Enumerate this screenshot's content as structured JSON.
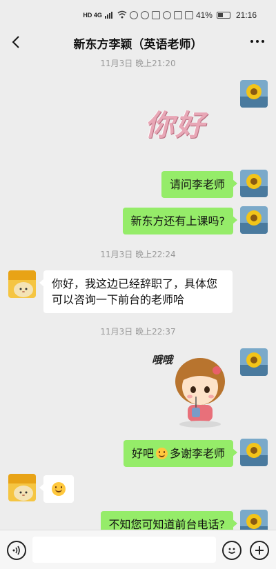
{
  "status_bar": {
    "network": "HD 4G",
    "battery": "41%",
    "battery_level": 0.41,
    "time": "21:16"
  },
  "header": {
    "title": "新东方李颖（英语老师）",
    "back_icon": "chevron-left-icon",
    "more_icon": "more-dots-icon"
  },
  "messages": [
    {
      "type": "timestamp",
      "text": "11月3日 晚上21:20"
    },
    {
      "type": "sticker",
      "side": "right",
      "sticker_text": "你好"
    },
    {
      "type": "text",
      "side": "right",
      "text": "请问李老师"
    },
    {
      "type": "text",
      "side": "right",
      "text": "新东方还有上课吗?"
    },
    {
      "type": "timestamp",
      "text": "11月3日 晚上22:24"
    },
    {
      "type": "text",
      "side": "left",
      "line1": "你好，我这边已经辞职了，具体您",
      "line2": "可以咨询一下前台的老师哈"
    },
    {
      "type": "timestamp",
      "text": "11月3日 晚上22:37"
    },
    {
      "type": "sticker",
      "side": "right",
      "sticker_text": "哦哦"
    },
    {
      "type": "text",
      "side": "right",
      "text_before": "好吧",
      "text_after": "多谢李老师",
      "emoji": "smile-emoji"
    },
    {
      "type": "emoji",
      "side": "left",
      "emoji": "smile-emoji"
    },
    {
      "type": "text",
      "side": "right",
      "text": "不知您可知道前台电话?"
    }
  ],
  "input_bar": {
    "placeholder": "",
    "voice_icon": "voice-icon",
    "emoji_icon": "emoji-icon",
    "plus_icon": "plus-icon"
  },
  "colors": {
    "background": "#ededed",
    "sent_bubble": "#95ec69",
    "received_bubble": "#ffffff",
    "timestamp_text": "#999999"
  }
}
